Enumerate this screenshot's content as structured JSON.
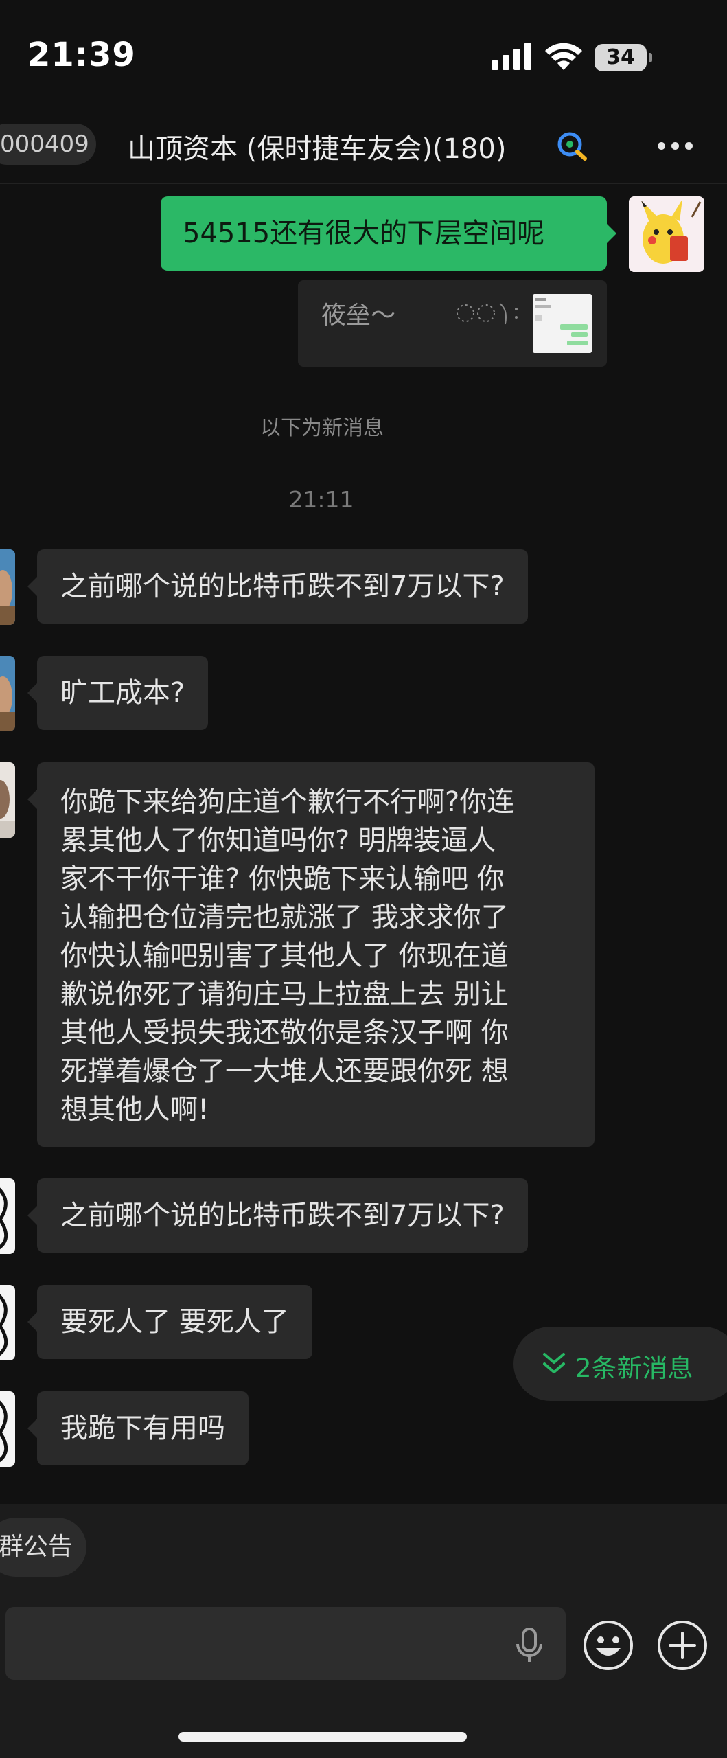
{
  "status_bar": {
    "time": "21:39",
    "battery": "34"
  },
  "header": {
    "back_label": "000409",
    "title": "山顶资本 (保时捷车友会)(180)"
  },
  "messages": {
    "outgoing": {
      "text": "54515还有很大的下层空间呢",
      "quote_text": "筱垒～"
    },
    "divider_label": "以下为新消息",
    "timestamp": "21:11",
    "incoming": [
      {
        "text": "之前哪个说的比特币跌不到7万以下?"
      },
      {
        "text": "旷工成本?"
      },
      {
        "text": "你跪下来给狗庄道个歉行不行啊?你连\n累其他人了你知道吗你? 明牌装逼人\n家不干你干谁? 你快跪下来认输吧  你\n认输把仓位清完也就涨了  我求求你了\n你快认输吧别害了其他人了  你现在道\n歉说你死了请狗庄马上拉盘上去  别让\n其他人受损失我还敬你是条汉子啊  你\n死撑着爆仓了一大堆人还要跟你死 想\n想其他人啊!"
      },
      {
        "text": "之前哪个说的比特币跌不到7万以下?"
      },
      {
        "text": "要死人了 要死人了"
      },
      {
        "text": "我跪下有用吗"
      }
    ]
  },
  "new_messages_label": "2条新消息",
  "bottom": {
    "notice_label": "群公告"
  },
  "colors": {
    "accent_green": "#2bb866",
    "background": "#111111",
    "bubble_incoming": "#2a2a2a"
  },
  "icons": [
    "signal-icon",
    "wifi-icon",
    "battery-icon",
    "search-chat-icon",
    "more-icon",
    "chevrons-down-icon",
    "mic-icon",
    "emoji-icon",
    "plus-icon"
  ]
}
